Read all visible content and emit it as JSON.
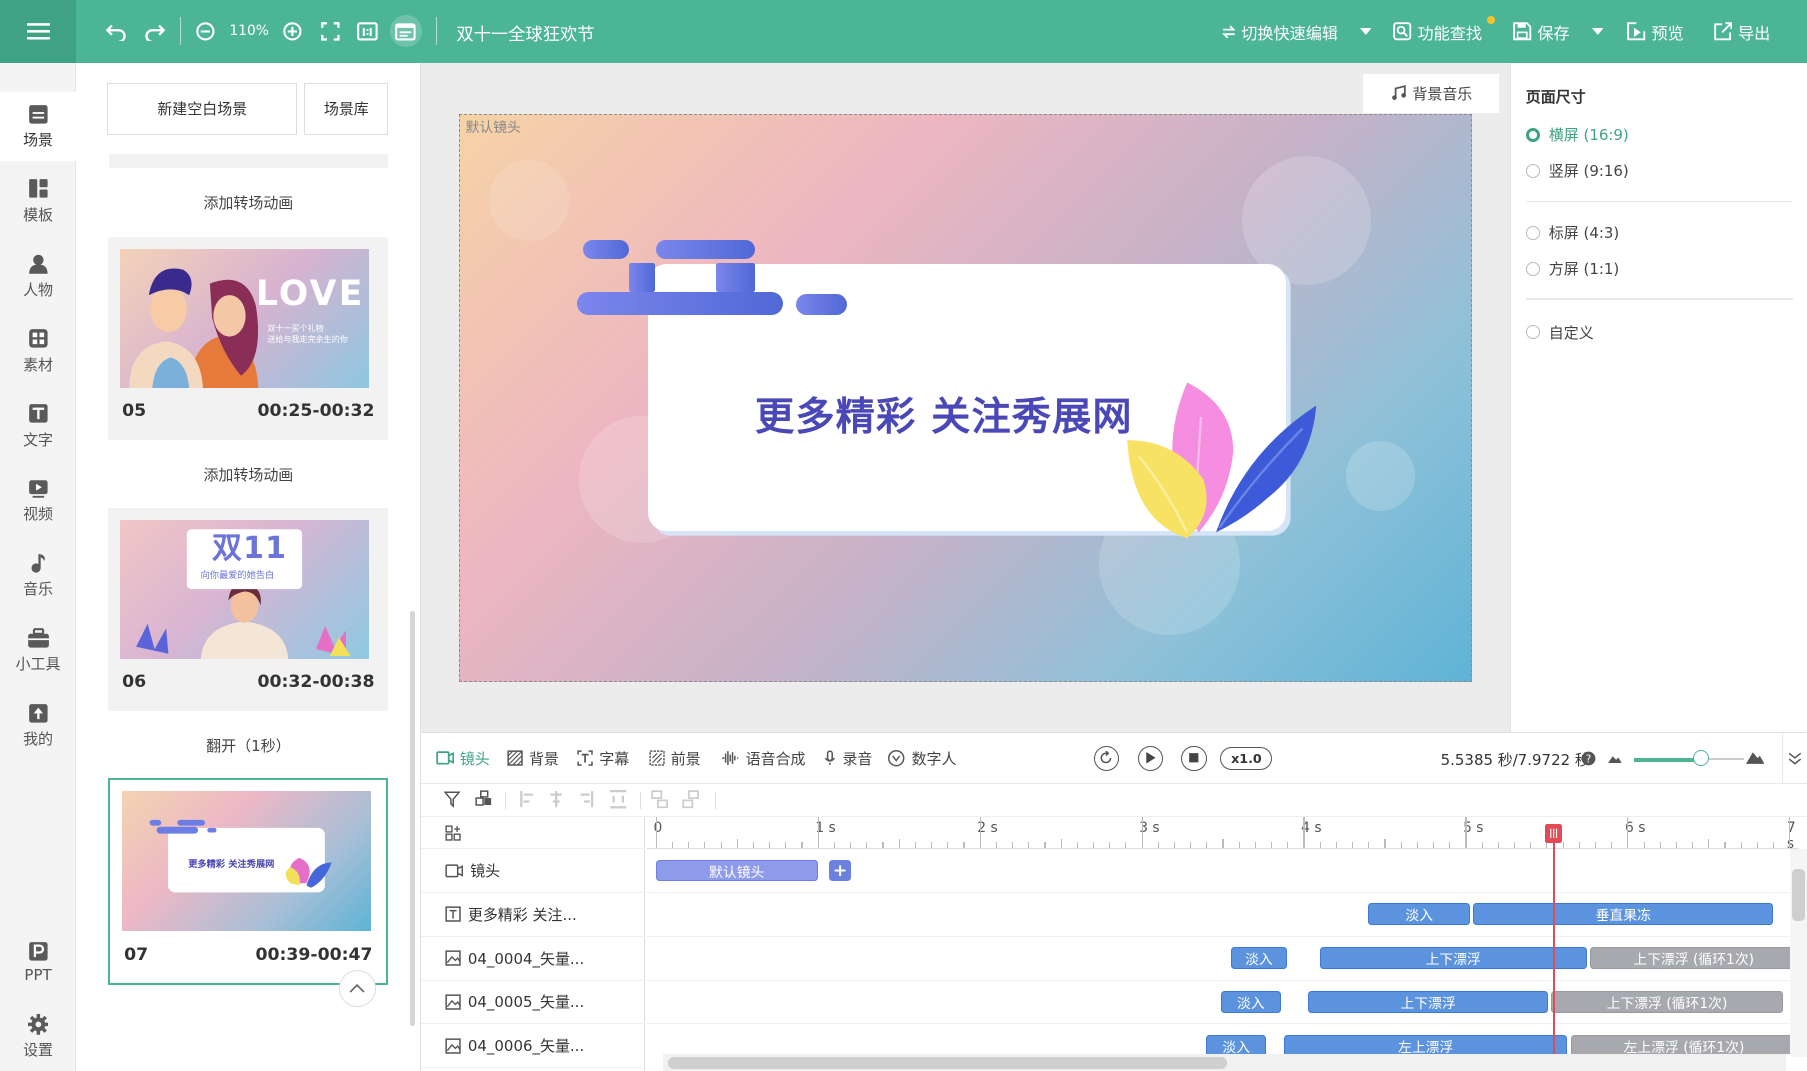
{
  "toolbar": {
    "zoom": "110%",
    "project_title": "双十一全球狂欢节",
    "switch_label": "切换快速编辑",
    "find_label": "功能查找",
    "save_label": "保存",
    "preview_label": "预览",
    "export_label": "导出"
  },
  "sidebar": {
    "items": [
      {
        "label": "场景",
        "icon": "scene-icon"
      },
      {
        "label": "模板",
        "icon": "template-icon"
      },
      {
        "label": "人物",
        "icon": "person-icon"
      },
      {
        "label": "素材",
        "icon": "material-icon"
      },
      {
        "label": "文字",
        "icon": "text-icon"
      },
      {
        "label": "视频",
        "icon": "video-icon"
      },
      {
        "label": "音乐",
        "icon": "music-icon"
      },
      {
        "label": "小工具",
        "icon": "toolbox-icon"
      },
      {
        "label": "我的",
        "icon": "upload-icon"
      },
      {
        "label": "PPT",
        "icon": "ppt-icon"
      },
      {
        "label": "设置",
        "icon": "gear-icon"
      }
    ]
  },
  "scene_panel": {
    "new_blank_label": "新建空白场景",
    "library_label": "场景库",
    "transitions": [
      "添加转场动画",
      "添加转场动画",
      "翻开（1秒）"
    ],
    "scenes": [
      {
        "number": "05",
        "time": "00:25-00:32",
        "thumb_title": "LOVE",
        "thumb_sub1": "双十一买个礼物",
        "thumb_sub2": "送给与我走完余生的你"
      },
      {
        "number": "06",
        "time": "00:32-00:38",
        "thumb_title": "双11",
        "thumb_sub1": "向你最爱的她告白"
      },
      {
        "number": "07",
        "time": "00:39-00:47",
        "thumb_sub1": "更多精彩 关注秀展网",
        "selected": true
      }
    ]
  },
  "canvas": {
    "bgm_label": "背景音乐",
    "camera_label": "默认镜头",
    "banner_text": "更多精彩 关注秀展网"
  },
  "page_size": {
    "title": "页面尺寸",
    "options": [
      {
        "label": "横屏 (16:9)",
        "selected": true
      },
      {
        "label": "竖屏 (9:16)",
        "selected": false
      },
      {
        "label": "标屏 (4:3)",
        "selected": false
      },
      {
        "label": "方屏 (1:1)",
        "selected": false
      },
      {
        "label": "自定义",
        "selected": false
      }
    ]
  },
  "timeline": {
    "tabs": [
      "镜头",
      "背景",
      "字幕",
      "前景",
      "语音合成",
      "录音",
      "数字人"
    ],
    "speed": "x1.0",
    "time_display": "5.5385 秒/7.9722 秒",
    "ruler_labels": [
      "0",
      "1 s",
      "2 s",
      "3 s",
      "4 s",
      "5 s",
      "6 s",
      "7 s"
    ],
    "playhead_seconds": 5.5385,
    "tracks": [
      {
        "label": "镜头",
        "icon": "camera-icon",
        "clips": [
          {
            "label": "默认镜头",
            "start": 0,
            "end": 1.0,
            "kind": "cam"
          }
        ]
      },
      {
        "label": "更多精彩 关注...",
        "icon": "text-track-icon",
        "clips": [
          {
            "label": "淡入",
            "start": 4.4,
            "end": 5.03,
            "kind": "blue"
          },
          {
            "label": "垂直果冻",
            "start": 5.05,
            "end": 6.9,
            "kind": "blue"
          }
        ]
      },
      {
        "label": "04_0004_矢量...",
        "icon": "image-track-icon",
        "clips": [
          {
            "label": "淡入",
            "start": 3.55,
            "end": 3.9,
            "kind": "blue"
          },
          {
            "label": "上下漂浮",
            "start": 4.1,
            "end": 5.75,
            "kind": "blue"
          },
          {
            "label": "上下漂浮 (循环1次)",
            "start": 5.77,
            "end": 7.05,
            "kind": "gray"
          }
        ]
      },
      {
        "label": "04_0005_矢量...",
        "icon": "image-track-icon",
        "clips": [
          {
            "label": "淡入",
            "start": 3.49,
            "end": 3.86,
            "kind": "blue"
          },
          {
            "label": "上下漂浮",
            "start": 4.03,
            "end": 5.51,
            "kind": "blue"
          },
          {
            "label": "上下漂浮 (循环1次)",
            "start": 5.53,
            "end": 6.96,
            "kind": "gray"
          }
        ]
      },
      {
        "label": "04_0006_矢量...",
        "icon": "image-track-icon",
        "clips": [
          {
            "label": "淡入",
            "start": 3.4,
            "end": 3.77,
            "kind": "blue"
          },
          {
            "label": "左上漂浮",
            "start": 3.88,
            "end": 5.63,
            "kind": "blue"
          },
          {
            "label": "左上漂浮 (循环1次)",
            "start": 5.65,
            "end": 7.05,
            "kind": "gray"
          }
        ]
      }
    ]
  }
}
